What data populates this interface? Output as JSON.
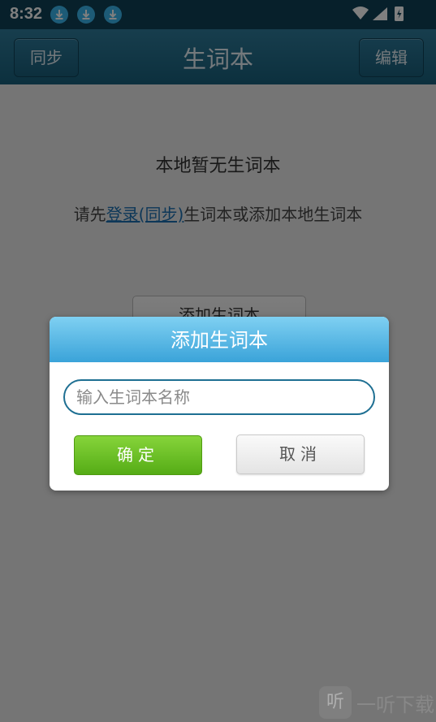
{
  "status_bar": {
    "time": "8:32"
  },
  "header": {
    "left_button": "同步",
    "title": "生词本",
    "right_button": "编辑"
  },
  "content": {
    "empty_title": "本地暂无生词本",
    "hint_prefix": "请先",
    "hint_link": "登录(同步)",
    "hint_suffix": "生词本或添加本地生词本",
    "add_button": "添加生词本"
  },
  "dialog": {
    "title": "添加生词本",
    "input_placeholder": "输入生词本名称",
    "ok_label": "确定",
    "cancel_label": "取消"
  },
  "watermark": {
    "logo": "听",
    "text": "一听下载"
  },
  "colors": {
    "header": "#18607c",
    "accent": "#3aa3d9",
    "ok": "#55ac16"
  }
}
